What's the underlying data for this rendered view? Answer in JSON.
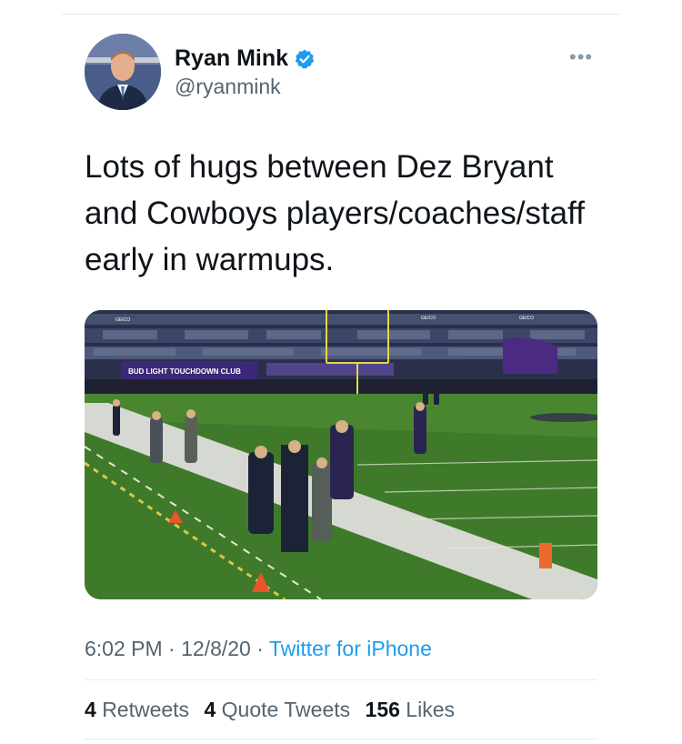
{
  "tweet": {
    "author_name": "Ryan Mink",
    "handle": "@ryanmink",
    "more_glyph": "•••",
    "text_lines": [
      "Lots of hugs between Dez Bryant",
      "and Cowboys players/coaches/staff",
      "early in warmups."
    ],
    "time": "6:02 PM",
    "date": "12/8/20",
    "separator": "·",
    "source": "Twitter for iPhone",
    "retweets_count": "4",
    "retweets_label": "Retweets",
    "quote_count": "4",
    "quote_label": "Quote Tweets",
    "likes_count": "156",
    "likes_label": "Likes"
  },
  "photo": {
    "stadium_banner": "BUD LIGHT TOUCHDOWN CLUB",
    "sponsor_signs": [
      "GEICO",
      "GEICO",
      "GEICO"
    ]
  },
  "colors": {
    "accent": "#1d9bf0",
    "muted_text": "#536471",
    "field_green": "#3f7a2a"
  }
}
